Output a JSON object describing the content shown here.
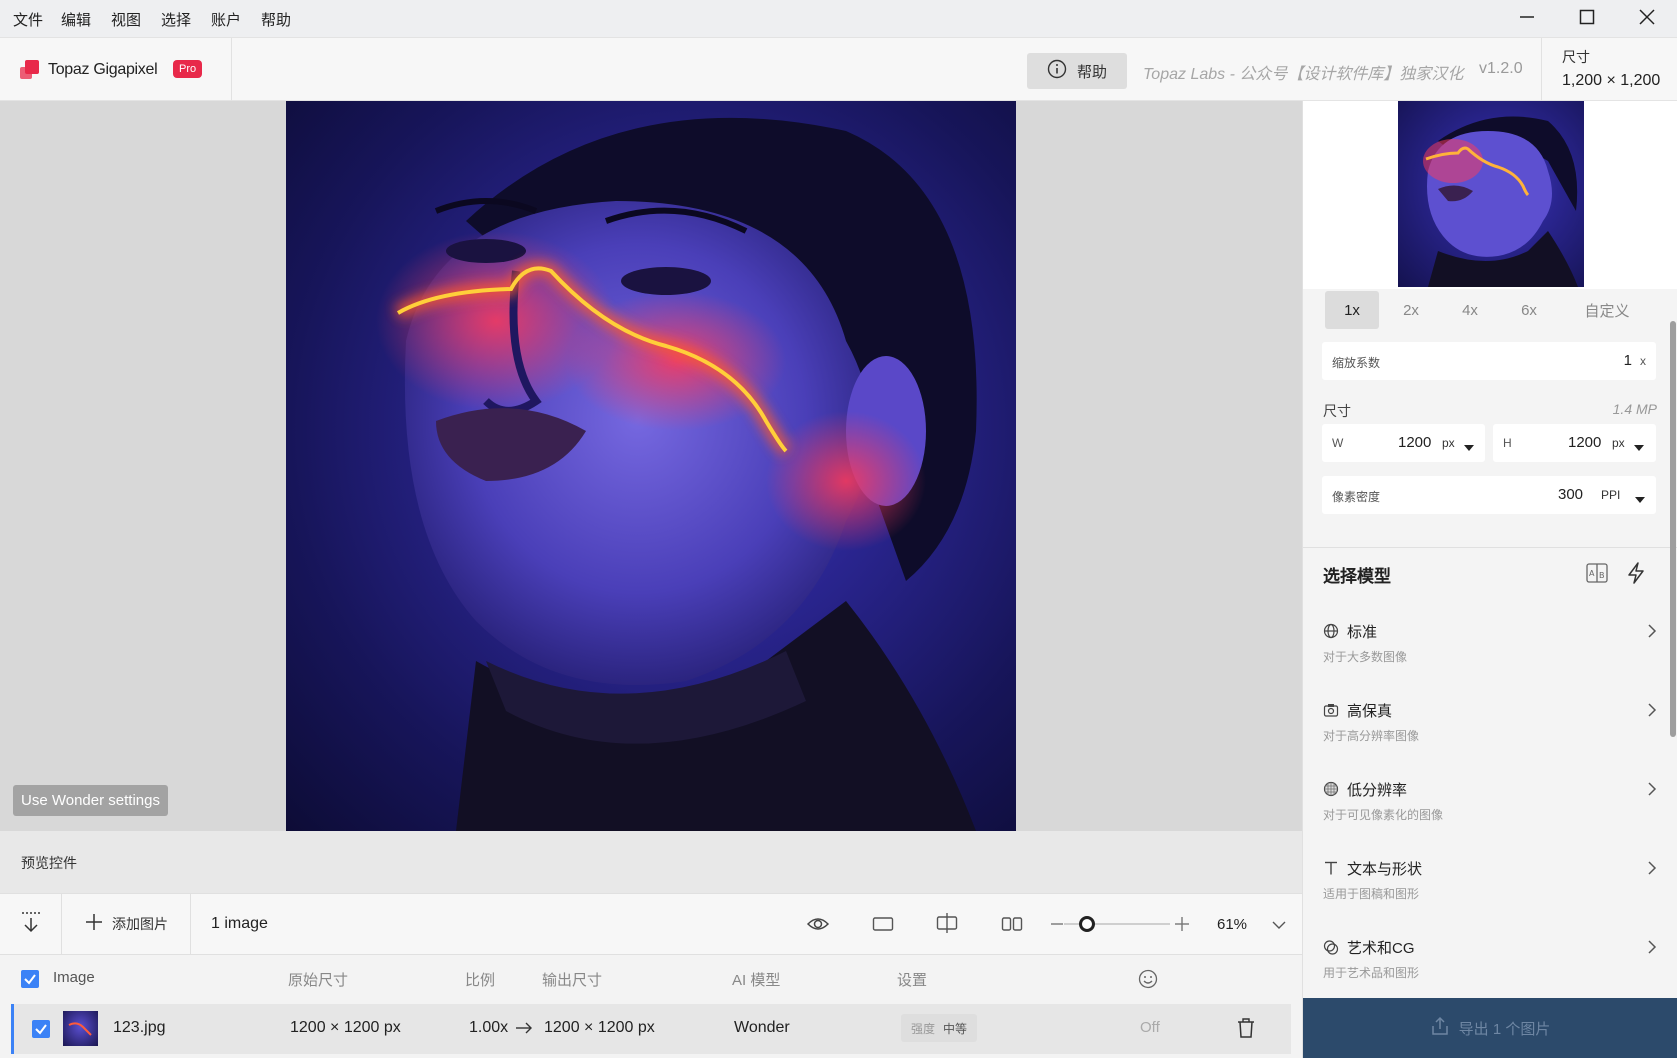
{
  "menu": {
    "items": [
      "文件",
      "编辑",
      "视图",
      "选择",
      "账户",
      "帮助"
    ]
  },
  "header": {
    "app_name": "Topaz Gigapixel",
    "badge": "Pro",
    "help_label": "帮助",
    "credit": "Topaz Labs - 公众号【设计软件库】独家汉化",
    "version": "v1.2.0",
    "size_label": "尺寸",
    "size_value": "1,200 × 1,200"
  },
  "preview": {
    "wonder_button": "Use Wonder settings",
    "controls_label": "预览控件"
  },
  "toolbar": {
    "add_image": "添加图片",
    "image_count": "1 image",
    "zoom": "61%",
    "zoom_fraction": 0.22
  },
  "table": {
    "headers": {
      "image": "Image",
      "original": "原始尺寸",
      "ratio": "比例",
      "output": "输出尺寸",
      "model": "AI 模型",
      "settings": "设置"
    },
    "rows": [
      {
        "name": "123.jpg",
        "original": "1200 × 1200 px",
        "ratio": "1.00x",
        "output": "1200 × 1200 px",
        "model": "Wonder",
        "strength_label": "强度",
        "strength_value": "中等",
        "face": "Off"
      }
    ]
  },
  "panel": {
    "scale_tabs": [
      "1x",
      "2x",
      "4x",
      "6x",
      "自定义"
    ],
    "scale_selected": "1x",
    "scale_factor_label": "缩放系数",
    "scale_factor_value": "1",
    "scale_factor_unit": "x",
    "dimensions_label": "尺寸",
    "megapixels": "1.4 MP",
    "width_label": "W",
    "width_value": "1200",
    "width_unit": "px",
    "height_label": "H",
    "height_value": "1200",
    "height_unit": "px",
    "ppi_label": "像素密度",
    "ppi_value": "300",
    "ppi_unit": "PPI",
    "model_section_title": "选择模型",
    "models": [
      {
        "icon": "globe-icon",
        "title": "标准",
        "subtitle": "对于大多数图像"
      },
      {
        "icon": "camera-icon",
        "title": "高保真",
        "subtitle": "对于高分辨率图像"
      },
      {
        "icon": "pixel-grid-icon",
        "title": "低分辨率",
        "subtitle": "对于可见像素化的图像"
      },
      {
        "icon": "text-icon",
        "title": "文本与形状",
        "subtitle": "适用于图稿和图形"
      },
      {
        "icon": "palette-icon",
        "title": "艺术和CG",
        "subtitle": "用于艺术品和图形"
      }
    ],
    "export_label": "导出 1 个图片"
  },
  "colors": {
    "accent_red": "#e8294a",
    "checkbox_blue": "#3b82f6",
    "export_bg": "#2c4a6b"
  }
}
